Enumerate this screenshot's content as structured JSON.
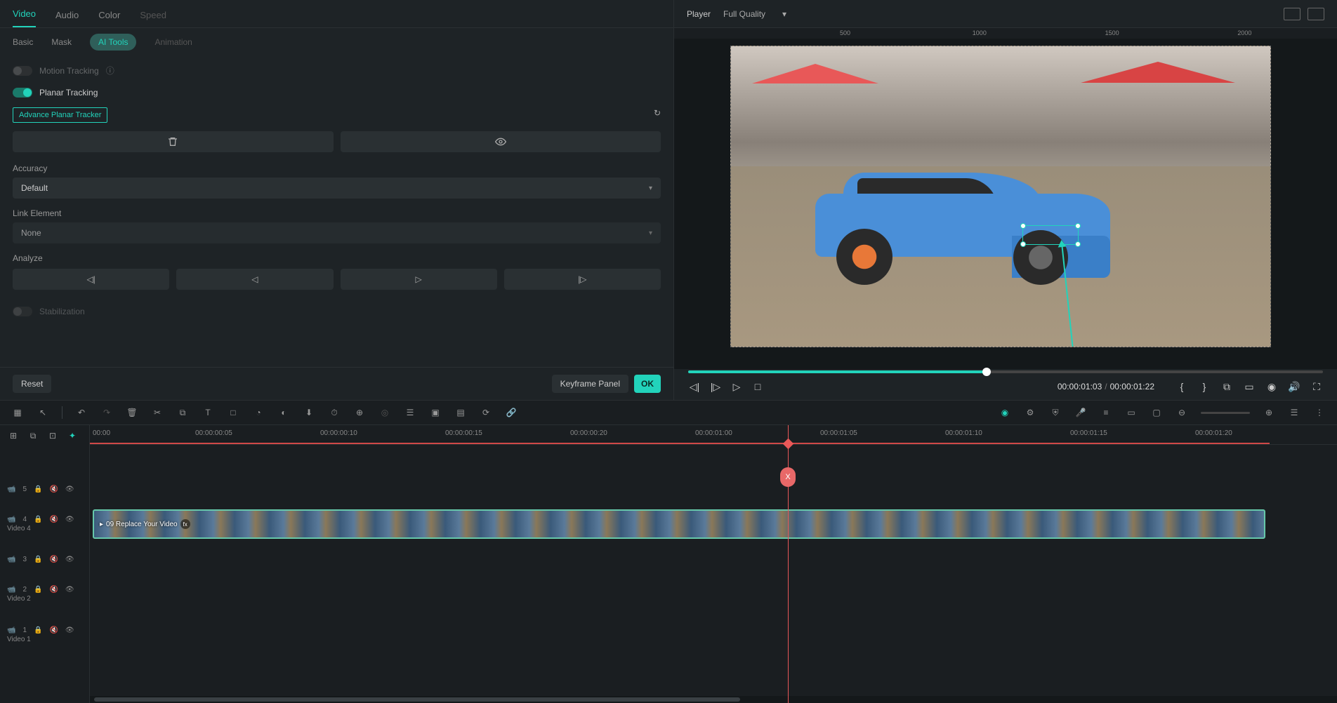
{
  "tabs_primary": [
    "Video",
    "Audio",
    "Color",
    "Speed"
  ],
  "tabs_primary_active": 0,
  "tabs_primary_disabled": [
    3
  ],
  "tabs_sub": [
    "Basic",
    "Mask",
    "AI Tools",
    "Animation"
  ],
  "tabs_sub_active": 2,
  "tabs_sub_disabled": [
    3
  ],
  "motion_tracking": {
    "label": "Motion Tracking",
    "on": false
  },
  "planar_tracking": {
    "label": "Planar Tracking",
    "on": true
  },
  "tracker_badge": "Advance Planar Tracker",
  "accuracy": {
    "label": "Accuracy",
    "value": "Default"
  },
  "link_element": {
    "label": "Link Element",
    "value": "None"
  },
  "analyze": {
    "label": "Analyze"
  },
  "stabilization": {
    "label": "Stabilization"
  },
  "footer_left": {
    "reset": "Reset",
    "keyframe_panel": "Keyframe Panel",
    "ok": "OK"
  },
  "player": {
    "label": "Player",
    "quality": "Full Quality",
    "ruler_ticks": [
      "500",
      "1000",
      "1500",
      "2000"
    ],
    "current_time": "00:00:01:03",
    "total_time": "00:00:01:22",
    "scrub_pct": 47
  },
  "timeline": {
    "ruler": [
      "00:00",
      "00:00:00:05",
      "00:00:00:10",
      "00:00:00:15",
      "00:00:00:20",
      "00:00:01:00",
      "00:00:01:05",
      "00:00:01:10",
      "00:00:01:15",
      "00:00:01:20",
      "00:00"
    ],
    "playhead_label": "X",
    "tracks": [
      {
        "idx": 5,
        "name": ""
      },
      {
        "idx": 4,
        "name": "Video 4",
        "clip": "09 Replace Your Video"
      },
      {
        "idx": 3,
        "name": ""
      },
      {
        "idx": 2,
        "name": "Video 2"
      },
      {
        "idx": 1,
        "name": "Video 1"
      }
    ]
  }
}
